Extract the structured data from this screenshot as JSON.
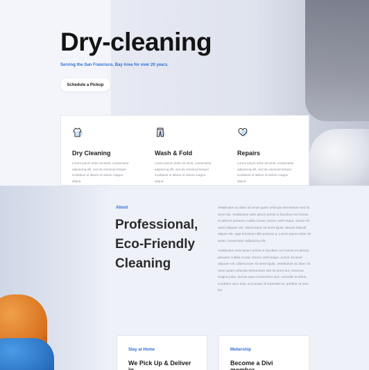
{
  "hero": {
    "title": "Dry-cleaning",
    "subtitle": "Serving the San Francisco, Bay Area for over 20 years.",
    "cta_label": "Schedule a Pickup"
  },
  "services": [
    {
      "icon": "shirt-icon",
      "title": "Dry Cleaning",
      "text": "Lorem ipsum dolor sit amet, consectetur adipiscing elit, sed do eiusmod tempor incididunt ut labore et dolore magna aliqua."
    },
    {
      "icon": "pants-icon",
      "title": "Wash & Fold",
      "text": "Lorem ipsum dolor sit amet, consectetur adipiscing elit, sed do eiusmod tempor incididunt ut labore et dolore magna aliqua."
    },
    {
      "icon": "heart-icon",
      "title": "Repairs",
      "text": "Lorem ipsum dolor sit amet, consectetur adipiscing elit, sed do eiusmod tempor incididunt ut labore et dolore magna aliqua."
    }
  ],
  "about": {
    "label": "About",
    "title_line1": "Professional,",
    "title_line2": "Eco-Friendly",
    "title_line3": "Cleaning",
    "paragraph1": "Vestibulum ac diam sit amet quam vehicula elementum sed sit amet dui. Vestibulum ante ipsum primis in faucibus orci luctus et ultrices posuere cubilia Curae; Donec velit neque, auctor sit amet aliquam vel, ullamcorper sit amet ligula. Mauris blandit aliquet elit, eget tincidunt nibh pulvinar a. Lorem ipsum dolor sit amet, consectetur adipiscing elit.",
    "paragraph2": "Vestibulum ante ipsum primis in faucibus orci luctus et ultrices posuere cubilia Curae; Donec velit neque, auctor sit amet aliquam vel, ullamcorper sit amet ligula. Vestibulum ac diam sit amet quam vehicula elementum sed sit amet dui. Vivamus magna justo, lacinia eget consectetur sed, convallis at tellus. Curabitur arcu erat, accumsan id imperdiet et, porttitor at sem. Do"
  },
  "cards": [
    {
      "label": "Stay at Home",
      "title": "We Pick Up & Deliver in"
    },
    {
      "label": "Mebership",
      "title": "Become a Divi member"
    }
  ],
  "colors": {
    "accent": "#2f6fd6",
    "background": "#eef1f8",
    "heading": "#141414"
  }
}
